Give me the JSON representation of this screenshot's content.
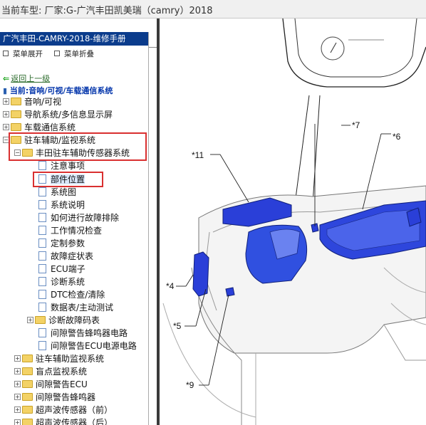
{
  "window": {
    "title": "当前车型:  厂家:G-广汽丰田凯美瑞（camry）2018"
  },
  "sidebar": {
    "manual_title": "广汽丰田-CAMRY-2018-维修手册",
    "expand_label": "菜单展开",
    "collapse_label": "菜单折叠",
    "back_label": "返回上一级",
    "current_path": "当前:音响/可视/车载通信系统",
    "tree": [
      {
        "label": "音响/可视"
      },
      {
        "label": "导航系统/多信息显示屏"
      },
      {
        "label": "车载通信系统"
      },
      {
        "label": "驻车辅助/监视系统"
      },
      {
        "label": "丰田驻车辅助传感器系统"
      },
      {
        "label": "注意事项"
      },
      {
        "label": "部件位置"
      },
      {
        "label": "系统图"
      },
      {
        "label": "系统说明"
      },
      {
        "label": "如何进行故障排除"
      },
      {
        "label": "工作情况检查"
      },
      {
        "label": "定制参数"
      },
      {
        "label": "故障症状表"
      },
      {
        "label": "ECU端子"
      },
      {
        "label": "诊断系统"
      },
      {
        "label": "DTC检查/清除"
      },
      {
        "label": "数据表/主动测试"
      },
      {
        "label": "诊断故障码表"
      },
      {
        "label": "间隙警告蜂鸣器电路"
      },
      {
        "label": "间隙警告ECU电源电路"
      },
      {
        "label": "驻车辅助监视系统"
      },
      {
        "label": "盲点监视系统"
      },
      {
        "label": "间隙警告ECU"
      },
      {
        "label": "间隙警告蜂鸣器"
      },
      {
        "label": "超声波传感器（前）"
      },
      {
        "label": "超声波传感器（后）"
      }
    ]
  },
  "diagram": {
    "callouts": [
      "*11",
      "*7",
      "*6",
      "*4",
      "*5",
      "*9"
    ]
  }
}
